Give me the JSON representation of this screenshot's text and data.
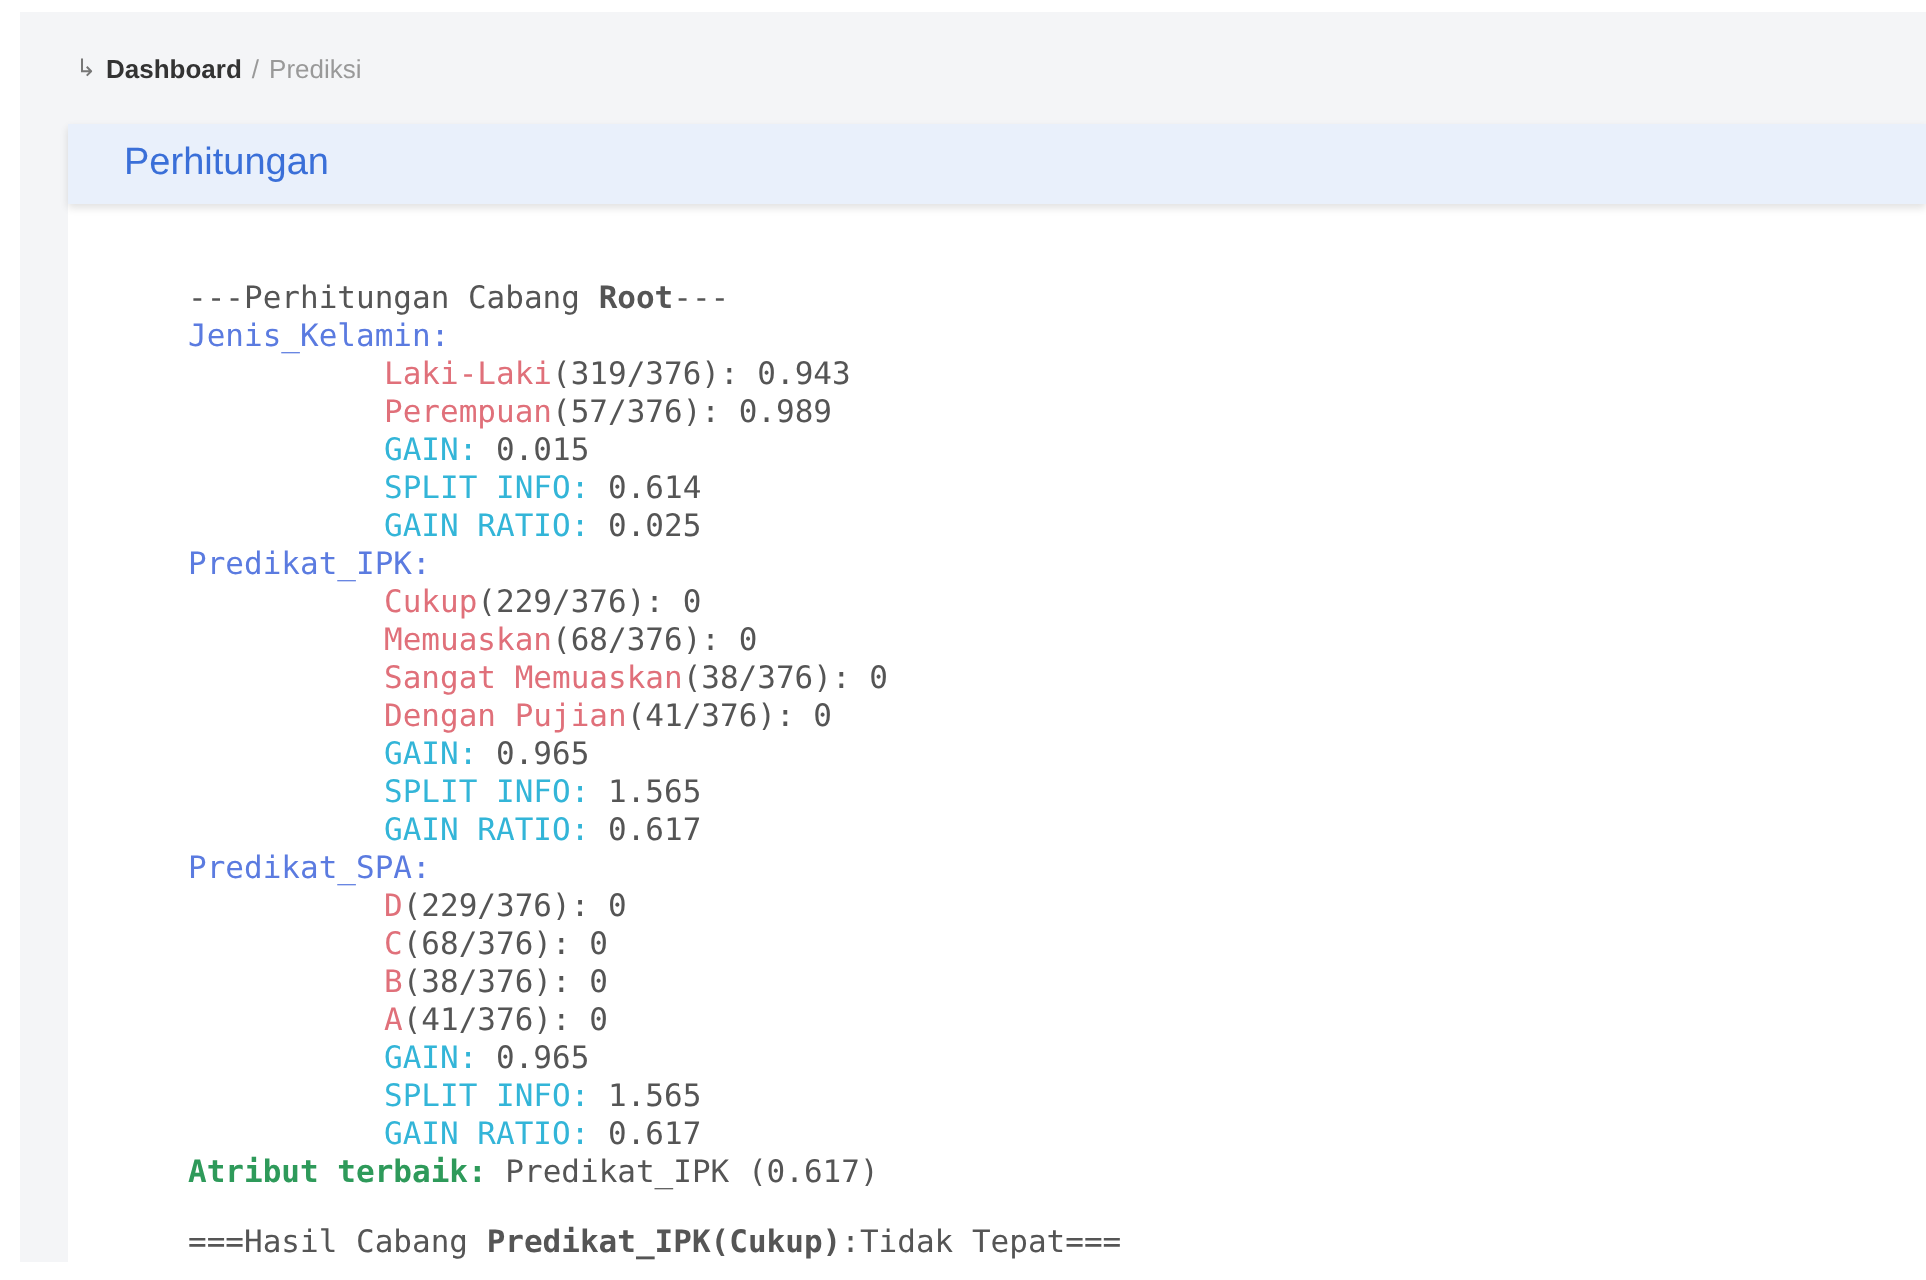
{
  "breadcrumb": {
    "icon": "↳",
    "items": [
      {
        "label": "Dashboard",
        "selected": false
      },
      {
        "label": "Prediksi",
        "selected": true
      }
    ],
    "separator": "/"
  },
  "card": {
    "title": "Perhitungan"
  },
  "log": [
    {
      "kind": "heading",
      "text": "---Perhitungan Cabang **Root**---"
    },
    {
      "kind": "attribute",
      "label": "Jenis_Kelamin:"
    },
    {
      "kind": "value",
      "label": "Laki-Laki",
      "value": "(319/376): 0.943"
    },
    {
      "kind": "value",
      "label": "Perempuan",
      "value": "(57/376): 0.989"
    },
    {
      "kind": "metric",
      "label": "GAIN:",
      "value": "0.015"
    },
    {
      "kind": "metric",
      "label": "SPLIT INFO:",
      "value": "0.614"
    },
    {
      "kind": "metric",
      "label": "GAIN RATIO:",
      "value": "0.025"
    },
    {
      "kind": "attribute",
      "label": "Predikat_IPK:"
    },
    {
      "kind": "value",
      "label": "Cukup",
      "value": "(229/376): 0"
    },
    {
      "kind": "value",
      "label": "Memuaskan",
      "value": "(68/376): 0"
    },
    {
      "kind": "value",
      "label": "Sangat Memuaskan",
      "value": "(38/376): 0"
    },
    {
      "kind": "value",
      "label": "Dengan Pujian",
      "value": "(41/376): 0"
    },
    {
      "kind": "metric",
      "label": "GAIN:",
      "value": "0.965"
    },
    {
      "kind": "metric",
      "label": "SPLIT INFO:",
      "value": "1.565"
    },
    {
      "kind": "metric",
      "label": "GAIN RATIO:",
      "value": "0.617"
    },
    {
      "kind": "attribute",
      "label": "Predikat_SPA:"
    },
    {
      "kind": "value",
      "label": "D",
      "value": "(229/376): 0"
    },
    {
      "kind": "value",
      "label": "C",
      "value": "(68/376): 0"
    },
    {
      "kind": "value",
      "label": "B",
      "value": "(38/376): 0"
    },
    {
      "kind": "value",
      "label": "A",
      "value": "(41/376): 0"
    },
    {
      "kind": "metric",
      "label": "GAIN:",
      "value": "0.965"
    },
    {
      "kind": "metric",
      "label": "SPLIT INFO:",
      "value": "1.565"
    },
    {
      "kind": "metric",
      "label": "GAIN RATIO:",
      "value": "0.617"
    },
    {
      "kind": "best",
      "label": "Atribut terbaik:",
      "value": "Predikat_IPK (0.617)"
    },
    {
      "kind": "result",
      "text": "===Hasil Cabang **Predikat_IPK(Cukup)**:Tidak Tepat==="
    }
  ]
}
